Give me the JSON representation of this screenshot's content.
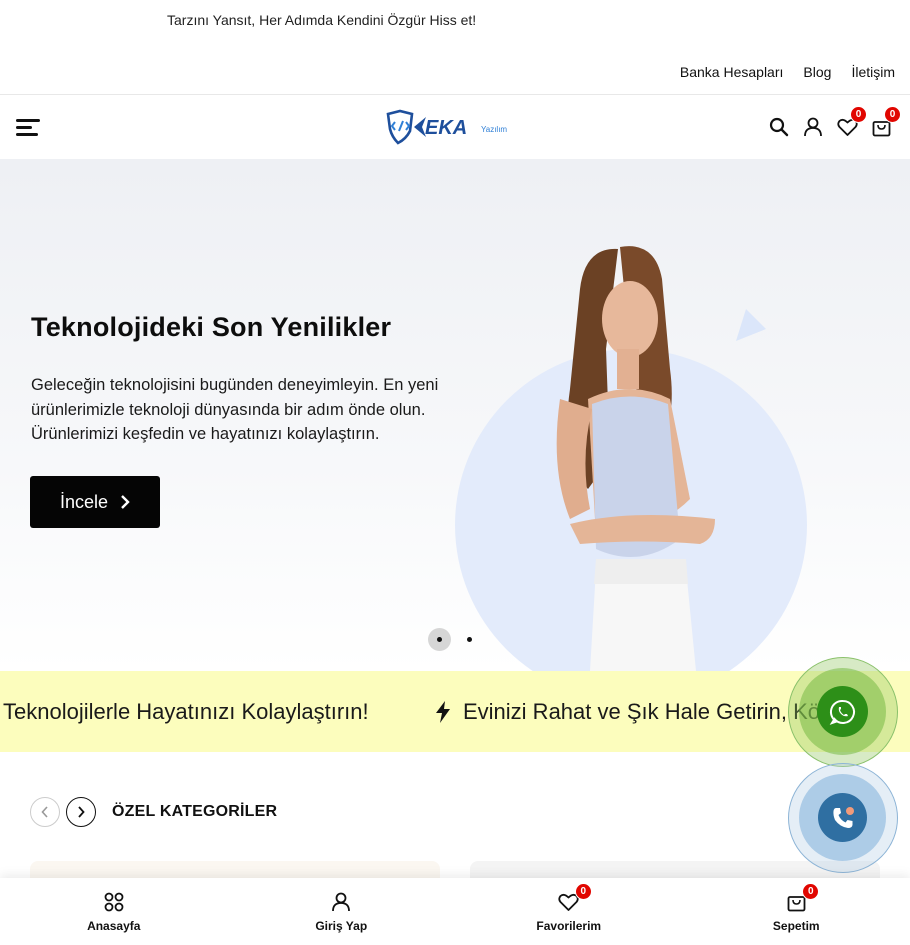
{
  "announcement": "Tarzını Yansıt, Her Adımda Kendini Özgür Hiss et!",
  "top_links": [
    "Banka Hesapları",
    "Blog",
    "İletişim"
  ],
  "header": {
    "logo_text": "EKA",
    "logo_sub": "Yazılım",
    "wishlist_count": "0",
    "cart_count": "0"
  },
  "hero": {
    "title": "Teknolojideki Son Yenilikler",
    "description": "Geleceğin teknolojisini bugünden deneyimleyin. En yeni ürünlerimizle teknoloji dünyasında bir adım önde olun. Ürünlerimizi keşfedin ve hayatınızı kolaylaştırın.",
    "button_label": "İncele",
    "active_slide": 1,
    "slide_count": 2
  },
  "marquee": {
    "text_1": "Teknolojilerle Hayatınızı Kolaylaştırın!",
    "text_2": "Evinizi Rahat ve Şık Hale Getirin, Köş"
  },
  "categories": {
    "title": "ÖZEL KATEGORİLER"
  },
  "bottom_nav": [
    {
      "label": "Anasayfa",
      "icon": "grid-icon"
    },
    {
      "label": "Giriş Yap",
      "icon": "user-icon"
    },
    {
      "label": "Favorilerim",
      "icon": "heart-icon",
      "badge": "0"
    },
    {
      "label": "Sepetim",
      "icon": "bag-icon",
      "badge": "0"
    }
  ],
  "colors": {
    "accent_dark": "#050505",
    "badge": "#e10600",
    "marquee_bg": "#fcfdbd",
    "logo_blue": "#1e4f9c",
    "whatsapp": "#2d8f18",
    "phone": "#2f6fa2"
  }
}
